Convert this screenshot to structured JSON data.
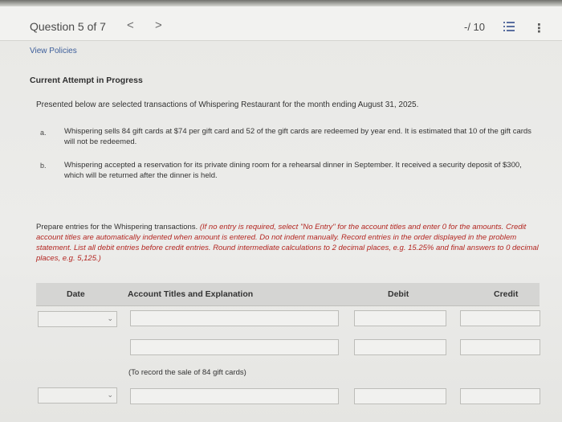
{
  "header": {
    "question_label": "Question 5 of 7",
    "prev_glyph": "<",
    "next_glyph": ">",
    "score": "-/ 10",
    "more_glyph": "⋮"
  },
  "links": {
    "view_policies": "View Policies"
  },
  "status": {
    "attempt": "Current Attempt in Progress"
  },
  "problem": {
    "intro": "Presented below are selected transactions of Whispering Restaurant for the month ending August 31, 2025.",
    "items": [
      {
        "letter": "a.",
        "text": "Whispering sells 84 gift cards at $74 per gift card and 52 of the gift cards are redeemed by year end. It is estimated that 10 of the gift cards will not be redeemed."
      },
      {
        "letter": "b.",
        "text": "Whispering accepted a reservation for its private dining room for a rehearsal dinner in September. It received a security deposit of $300, which will be returned after the dinner is held."
      }
    ],
    "instructions_plain": "Prepare entries for the Whispering transactions. ",
    "instructions_red": "(If no entry is required, select \"No Entry\" for the account titles and enter 0 for the amounts. Credit account titles are automatically indented when amount is entered. Do not indent manually. Record entries in the order displayed in the problem statement. List all debit entries before credit entries. Round intermediate calculations to 2 decimal places, e.g. 15.25% and final answers to 0 decimal places, e.g. 5,125.)"
  },
  "table": {
    "headers": {
      "date": "Date",
      "account": "Account Titles and Explanation",
      "debit": "Debit",
      "credit": "Credit"
    },
    "rows": [
      {
        "date": "",
        "account": "",
        "debit": "",
        "credit": ""
      },
      {
        "date": "",
        "account": "",
        "debit": "",
        "credit": ""
      },
      {
        "date": "",
        "account": "",
        "debit": "",
        "credit": ""
      }
    ],
    "note": "(To record the sale of 84 gift cards)"
  },
  "colors": {
    "link": "#3d5e9a",
    "instruction_red": "#b32621",
    "header_bg": "#d5d5d3"
  }
}
